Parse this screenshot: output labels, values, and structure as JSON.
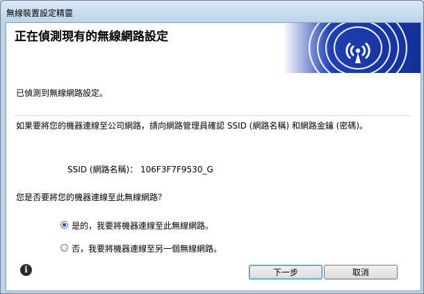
{
  "window": {
    "title": "無線裝置設定精靈"
  },
  "banner": {
    "title": "正在偵測現有的無線網路設定"
  },
  "body": {
    "detected_text": "已偵測到無線網路設定。",
    "instruction_text": "如果要將您的機器連線至公司網路，請向網路管理員確認 SSID (網路名稱) 和網路金鑰 (密碼)。",
    "ssid_label": "SSID (網路名稱)：",
    "ssid_value": "106F3F7F9530_G",
    "question_text": "您是否要將您的機器連線至此無線網路？",
    "options": [
      {
        "label": "是的，我要將機器連線至此無線網路。",
        "selected": true
      },
      {
        "label": "否，我要將機器連線至另一個無線網路。",
        "selected": false
      }
    ]
  },
  "buttons": {
    "next_label": "下一步",
    "cancel_label": "取消"
  },
  "icons": {
    "info": "info-icon",
    "wireless": "wireless-logo-icon"
  },
  "colors": {
    "banner_blue": "#1a3aa8",
    "titlebar": "#bcd3ec"
  }
}
